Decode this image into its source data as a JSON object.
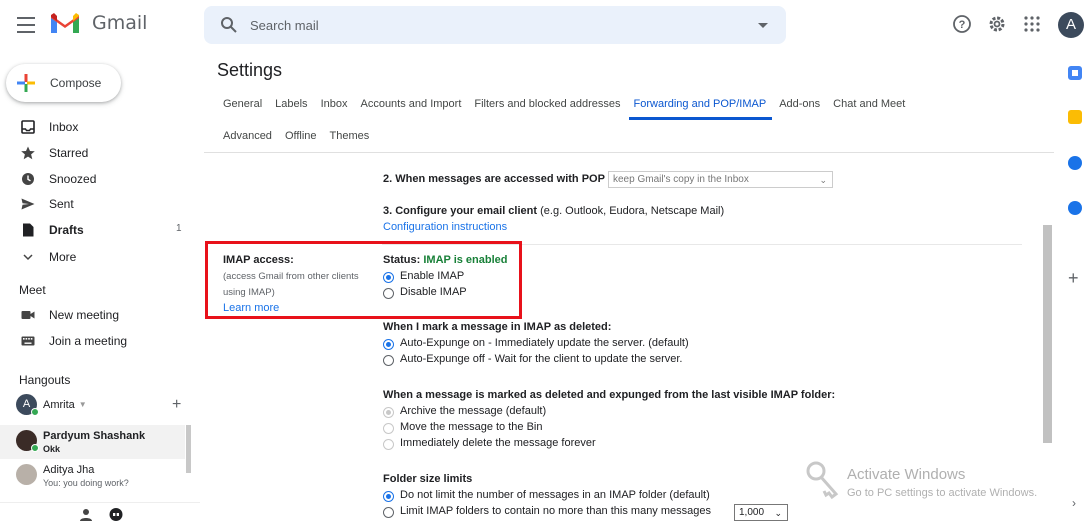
{
  "app": {
    "name": "Gmail",
    "avatar_letter": "A"
  },
  "search": {
    "placeholder": "Search mail"
  },
  "compose": {
    "label": "Compose"
  },
  "nav": [
    {
      "label": "Inbox",
      "icon": "inbox-icon",
      "count": ""
    },
    {
      "label": "Starred",
      "icon": "star-icon",
      "count": ""
    },
    {
      "label": "Snoozed",
      "icon": "clock-icon",
      "count": ""
    },
    {
      "label": "Sent",
      "icon": "send-icon",
      "count": ""
    },
    {
      "label": "Drafts",
      "icon": "draft-icon",
      "count": "1"
    },
    {
      "label": "More",
      "icon": "chevron-down-icon",
      "count": ""
    }
  ],
  "meet": {
    "title": "Meet",
    "items": [
      {
        "label": "New meeting",
        "icon": "video-icon"
      },
      {
        "label": "Join a meeting",
        "icon": "keyboard-icon"
      }
    ]
  },
  "hangouts": {
    "title": "Hangouts",
    "user": "Amrita",
    "user_letter": "A",
    "contacts": [
      {
        "name": "Pardyum Shashank",
        "sub": "Okk"
      },
      {
        "name": "Aditya Jha",
        "sub": "You: you doing work?"
      }
    ]
  },
  "settings": {
    "title": "Settings",
    "tabs_row1": [
      "General",
      "Labels",
      "Inbox",
      "Accounts and Import",
      "Filters and blocked addresses",
      "Forwarding and POP/IMAP",
      "Add-ons",
      "Chat and Meet"
    ],
    "tabs_row2": [
      "Advanced",
      "Offline",
      "Themes"
    ],
    "active_tab": "Forwarding and POP/IMAP"
  },
  "pop": {
    "step2_label": "2. When messages are accessed with POP",
    "step2_select": "keep Gmail's copy in the Inbox",
    "step3_label": "3. Configure your email client",
    "step3_hint": "(e.g. Outlook, Eudora, Netscape Mail)",
    "config_link": "Configuration instructions"
  },
  "imap": {
    "title": "IMAP access:",
    "desc_line1": "(access Gmail from other clients",
    "desc_line2": "using IMAP)",
    "learn_more": "Learn more",
    "status_label": "Status:",
    "status_value": "IMAP is enabled",
    "enable": "Enable IMAP",
    "disable": "Disable IMAP",
    "deleted_title": "When I mark a message in IMAP as deleted:",
    "deleted_opt1": "Auto-Expunge on - Immediately update the server. (default)",
    "deleted_opt2": "Auto-Expunge off - Wait for the client to update the server.",
    "expunged_title": "When a message is marked as deleted and expunged from the last visible IMAP folder:",
    "expunged_opt1": "Archive the message (default)",
    "expunged_opt2": "Move the message to the Bin",
    "expunged_opt3": "Immediately delete the message forever",
    "folder_title": "Folder size limits",
    "folder_opt1": "Do not limit the number of messages in an IMAP folder (default)",
    "folder_opt2": "Limit IMAP folders to contain no more than this many messages",
    "folder_limit": "1,000"
  },
  "watermark": {
    "line1": "Activate Windows",
    "line2": "Go to PC settings to activate Windows."
  },
  "colors": {
    "accent": "#0b57d0",
    "link": "#1a73e8",
    "status_green": "#188038",
    "highlight_red": "#e8111a"
  }
}
